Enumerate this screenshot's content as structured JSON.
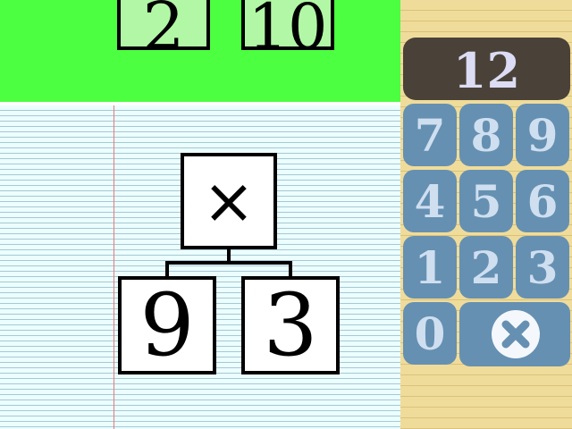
{
  "top_tiles": {
    "left": "2",
    "right": "10"
  },
  "tree": {
    "operator": "×",
    "left_operand": "9",
    "right_operand": "3"
  },
  "keypad": {
    "display": "12",
    "keys": [
      "7",
      "8",
      "9",
      "4",
      "5",
      "6",
      "1",
      "2",
      "3",
      "0"
    ],
    "clear_icon": "clear-circle-x-icon"
  },
  "colors": {
    "top_background": "#4cff40",
    "tile_fill": "#b2f7a6",
    "paper": "#ecfdfd",
    "key_fill": "#6590b2",
    "display_fill": "#4a4238",
    "panel_background": "#f0dc9a"
  }
}
